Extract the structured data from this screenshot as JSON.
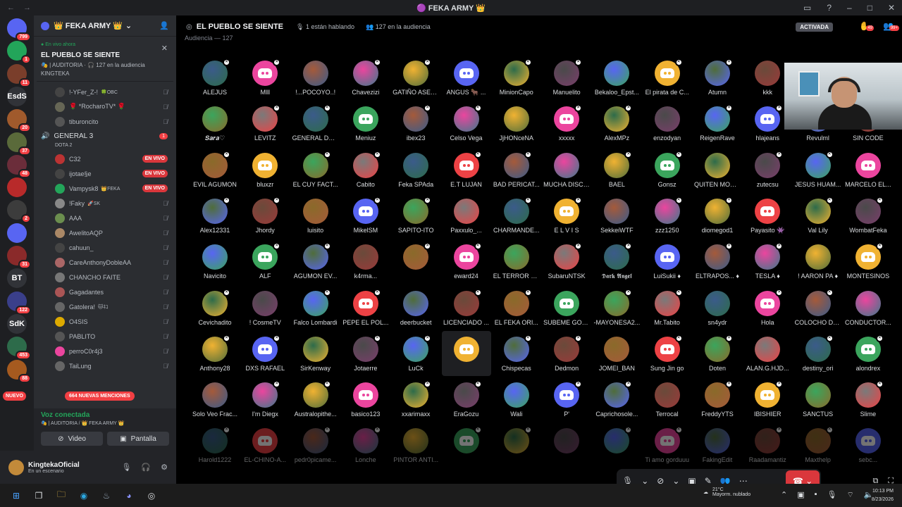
{
  "window": {
    "title": "🟣 FEKA ARMY 👑"
  },
  "servers": [
    {
      "label": "",
      "badge": "799",
      "color": "#5865f2"
    },
    {
      "label": "",
      "badge": "1",
      "color": "#23a55a"
    },
    {
      "label": "",
      "badge": "11",
      "color": "#7a3e2b"
    },
    {
      "label": "EsdS",
      "badge": "",
      "color": "#313338"
    },
    {
      "label": "",
      "badge": "20",
      "color": "#a05a2c"
    },
    {
      "label": "",
      "badge": "37",
      "color": "#5a6a3a"
    },
    {
      "label": "",
      "badge": "48",
      "color": "#6b2d3a"
    },
    {
      "label": "",
      "badge": "",
      "color": "#b82a2a"
    },
    {
      "label": "",
      "badge": "2",
      "color": "#3c3c3c"
    },
    {
      "label": "",
      "badge": "",
      "color": "#5865f2"
    },
    {
      "label": "",
      "badge": "31",
      "color": "#8a2a2a"
    },
    {
      "label": "BT",
      "badge": "",
      "color": "#313338"
    },
    {
      "label": "",
      "badge": "122",
      "color": "#3a3f8a"
    },
    {
      "label": "SdK",
      "badge": "",
      "color": "#313338"
    },
    {
      "label": "",
      "badge": "453",
      "color": "#2d6b4a"
    },
    {
      "label": "",
      "badge": "88",
      "color": "#a55a1f"
    }
  ],
  "new_label": "NUEVO",
  "guild": {
    "name": "👑 FEKA ARMY 👑"
  },
  "live_card": {
    "status": "En vivo ahora",
    "stage": "EL PUEBLO SE SIENTE",
    "meta": "🎭 | AUDITORIA · 🎧 127 en la audiencia",
    "host": "KINGTEKA"
  },
  "members_top": [
    {
      "name": "!-YFer_Z-!",
      "tag": "🍀OBC",
      "color": "#444"
    },
    {
      "name": "🌹 *RocharoTV* 🌹",
      "tag": "",
      "color": "#665"
    },
    {
      "name": "tiburoncito",
      "tag": "",
      "color": "#555"
    }
  ],
  "voice_channel": {
    "name": "GENERAL 3",
    "count": "1",
    "game": "DOTA 2"
  },
  "members": [
    {
      "name": "C32",
      "color": "#b33",
      "live": "EN VIVO"
    },
    {
      "name": "ijotae§e",
      "color": "#444",
      "live": "EN VIVO"
    },
    {
      "name": "Vampysk8",
      "tag": "👑FEKA",
      "color": "#23a55a",
      "live": "EN VIVO"
    },
    {
      "name": "!Faky",
      "tag": "🚀SK",
      "color": "#888",
      "live": ""
    },
    {
      "name": "AAA",
      "color": "#6b8e4e",
      "live": ""
    },
    {
      "name": "AwelitoAQP",
      "color": "#a86",
      "live": ""
    },
    {
      "name": "cahuun_",
      "color": "#444",
      "live": ""
    },
    {
      "name": "CareAnthonyDobleAA",
      "color": "#a66",
      "live": ""
    },
    {
      "name": "CHANCHO FAITE",
      "color": "#777",
      "live": ""
    },
    {
      "name": "Gagadantes",
      "color": "#a55",
      "live": ""
    },
    {
      "name": "Gatolera!",
      "tag": "🐱ﾈｺ",
      "color": "#666",
      "live": ""
    },
    {
      "name": "O4SIS",
      "color": "#da0",
      "live": ""
    },
    {
      "name": "PABLITO",
      "color": "#555",
      "live": ""
    },
    {
      "name": "perroC0r4j3",
      "color": "#eb459e",
      "live": ""
    },
    {
      "name": "TaiLung",
      "color": "#666",
      "live": ""
    }
  ],
  "mentions": "664 NUEVAS MENCIONES",
  "voice_panel": {
    "status": "Voz conectada",
    "sub": "🎭 | AUDITORIA / 👑 FEKA ARMY 👑",
    "video": "Video",
    "share": "Pantalla"
  },
  "user": {
    "name": "KingtekaOficial",
    "status": "En un escenario"
  },
  "stage": {
    "name": "EL PUEBLO SE SIENTE",
    "speaking": "1 están hablando",
    "audience": "127 en la audiencia",
    "active": "ACTIVADA",
    "audience_header": "Audiencia — 127",
    "badge1": "49",
    "badge2": "99+"
  },
  "audience": [
    [
      "ALEJUS",
      "Mlll",
      "!...POCOYO..!",
      "Chavezizi",
      "GATIÑO ASES...",
      "ANGUS 🐂 ...",
      "MinionCapo",
      "Manuelito",
      "Bekaloo_Epst...",
      "El pirata de C...",
      "Atumn",
      "kkk",
      "",
      ""
    ],
    [
      "𝑺𝒂𝒓𝒂♡",
      "LEVITZ",
      "GENERAL DE ...",
      "Meniuz",
      "ibex23",
      "Celso Vega",
      "JjHONceNA",
      "xxxxx",
      "AlexMPz",
      "enzodyan",
      "ReigenRave",
      "hlajeans",
      "Revulml",
      "SIN CODE"
    ],
    [
      "EVIL AGUMON",
      "bluxzr",
      "EL CUY FACT...",
      "Cabito",
      "Feka SPAda",
      "E.T LUJAN",
      "BAD PERICAT...",
      "MUCHA DISCI...",
      "BAEL",
      "Gonsz",
      "QUITEN MOD ...",
      "zutecsu",
      "JESUS HUAM...",
      "MARCELO EL..."
    ],
    [
      "Alex12331",
      "Jhordy",
      "luisito",
      "MikelSM",
      "SAPITO-ITO",
      "Paxxulo_...",
      "CHARMANDE...",
      "E L V I S",
      "SekkeiWTF",
      "zzz1250",
      "diomegod1",
      "Payasito 👾",
      "Val Lily",
      "WombatFeka"
    ],
    [
      "Navicito",
      "ALF",
      "AGUMON EV...",
      "k4rma...",
      "",
      "eward24",
      "EL TERROR D...",
      "SubaruNTSK",
      "𝕯𝖆𝖗𝖐 𝕬𝖓𝖌𝖊𝖑",
      "LuiSukii ♦",
      "ELTRAPOS... ♦",
      "TESLA ♦",
      "! AARON PA ♦",
      "MONTESINOS"
    ],
    [
      "Cevichadito",
      "! CosmeTV",
      "Falco Lombardi",
      "PEPE EL POL...",
      "deerbucket",
      "LICENCIADO ...",
      "EL FEKA ORI...",
      "SUBEME GOR...",
      "-MAYONESA2...",
      "Mr.Tabito",
      "sn4ydr",
      "Hola",
      "COLOCHO DE...",
      "CONDUCTOR..."
    ],
    [
      "Anthony28",
      "DXS RAFAEL",
      "SirKenway",
      "Jotaerre",
      "LuCk",
      "",
      "Chispecas",
      "Dedmon",
      "JOMEI_BAN",
      "Sung Jin go",
      "Doten",
      "ALAN.G.HJD...",
      "destiny_ori",
      "alondrex"
    ],
    [
      "Solo Veo Frac...",
      "I'm Diegx",
      "Australopithe...",
      "basico123",
      "xxarimaxx",
      "EraGozu",
      "Wali",
      "P'",
      "Caprichosole...",
      "Terrocal",
      "FreddyYTS",
      "IBISHIER",
      "SANCTUS",
      "Slime"
    ],
    [
      "Harold1222",
      "EL-CHINO-A...",
      "pedr0picame...",
      "Lonche",
      "PINTOR ANTI...",
      "",
      "",
      "",
      "",
      "Ti amo gorduuu",
      "FakingEdit",
      "Raadamantiz",
      "Maxthelp",
      "sebc..."
    ]
  ],
  "colors": {
    "accent": "#5865f2",
    "live": "#da373c",
    "online": "#23a55a",
    "discord_pink": "#eb459e",
    "discord_orange": "#f0b232",
    "discord_red": "#ed4245",
    "discord_green": "#3ba55d"
  },
  "taskbar": {
    "weather_temp": "21°C",
    "weather_desc": "Mayorm. nublado",
    "time": "10:13 PM",
    "date": "8/23/2026"
  }
}
